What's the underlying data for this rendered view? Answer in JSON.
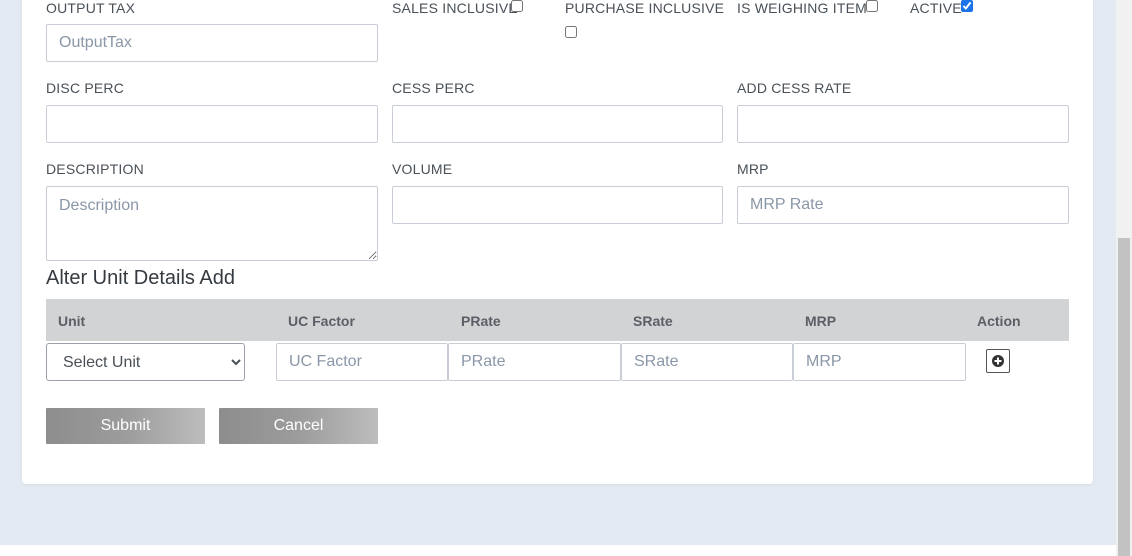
{
  "form": {
    "output_tax": {
      "label": "OUTPUT TAX",
      "placeholder": "OutputTax",
      "value": ""
    },
    "sales_inclusive": {
      "label": "SALES INCLUSIVE",
      "checked": false
    },
    "purchase_inclusive": {
      "label": "PURCHASE INCLUSIVE",
      "checked": false
    },
    "is_weighing_item": {
      "label": "IS WEIGHING ITEM",
      "checked": false
    },
    "active": {
      "label": "ACTIVE",
      "checked": true
    },
    "disc_perc": {
      "label": "DISC PERC",
      "placeholder": "",
      "value": ""
    },
    "cess_perc": {
      "label": "CESS PERC",
      "placeholder": "",
      "value": ""
    },
    "add_cess_rate": {
      "label": "ADD CESS RATE",
      "placeholder": "",
      "value": ""
    },
    "description": {
      "label": "DESCRIPTION",
      "placeholder": "Description",
      "value": ""
    },
    "volume": {
      "label": "VOLUME",
      "placeholder": "",
      "value": ""
    },
    "mrp": {
      "label": "MRP",
      "placeholder": "MRP Rate",
      "value": ""
    }
  },
  "alter_unit": {
    "title": "Alter Unit Details Add",
    "columns": [
      "Unit",
      "UC Factor",
      "PRate",
      "SRate",
      "MRP",
      "Action"
    ],
    "row": {
      "unit_selected": "Select Unit",
      "uc_factor_placeholder": "UC Factor",
      "prate_placeholder": "PRate",
      "srate_placeholder": "SRate",
      "mrp_placeholder": "MRP",
      "action_icon": "plus-circle-icon"
    }
  },
  "buttons": {
    "submit": "Submit",
    "cancel": "Cancel"
  },
  "colors": {
    "page_bg": "#e4eaf3",
    "card_bg": "#ffffff",
    "table_header_bg": "#d2d3d5",
    "button_gradient_start": "#8d8d8d",
    "button_gradient_end": "#bdbdbd",
    "checkbox_accent": "#1a73e8"
  }
}
